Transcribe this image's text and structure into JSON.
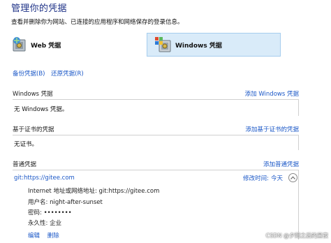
{
  "header": {
    "title": "管理你的凭据",
    "subtitle": "查看并删除你为网站、已连接的应用程序和网络保存的登录信息。"
  },
  "categories": {
    "web": {
      "label": "Web 凭据",
      "icon": "web-vault-icon"
    },
    "windows": {
      "label": "Windows 凭据",
      "icon": "windows-vault-icon",
      "selected": true
    }
  },
  "actions": {
    "backup": "备份凭据(B)",
    "restore": "还原凭据(R)"
  },
  "sections": {
    "windows": {
      "title": "Windows 凭据",
      "add": "添加 Windows 凭据",
      "empty": "无 Windows 凭据。"
    },
    "cert": {
      "title": "基于证书的凭据",
      "add": "添加基于证书的凭据",
      "empty": "无证书。"
    },
    "generic": {
      "title": "普通凭据",
      "add": "添加普通凭据"
    }
  },
  "credential": {
    "name": "git:https://gitee.com",
    "modified_label": "修改时间:",
    "modified_value": "今天",
    "address_label": "Internet 地址或网络地址:",
    "address_value": "git:https://gitee.com",
    "user_label": "用户名:",
    "user_value": "night-after-sunset",
    "password_label": "密码:",
    "password_value": "••••••••",
    "persist_label": "永久性:",
    "persist_value": "企业",
    "edit": "编辑",
    "delete": "删除"
  },
  "watermark": "CSDN @夕阳之后的黑夜",
  "colors": {
    "link": "#1a57c7",
    "title": "#1e3287",
    "selected_bg": "#d9ebf9"
  }
}
